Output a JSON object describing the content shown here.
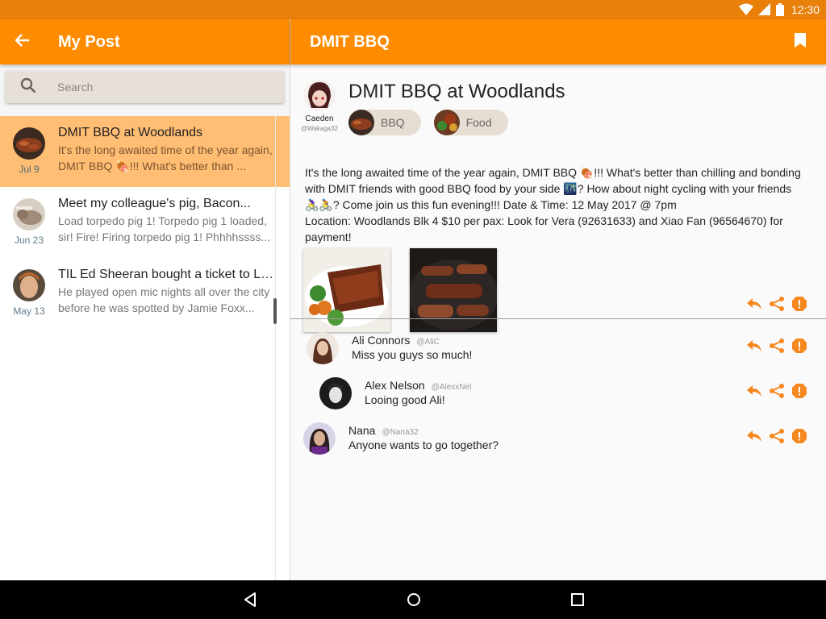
{
  "status_bar": {
    "time": "12:30"
  },
  "left_appbar": {
    "title": "My Post"
  },
  "search": {
    "placeholder": "Search"
  },
  "posts": [
    {
      "title": "DMIT BBQ at Woodlands",
      "snippet": "It's the long awaited time of the year again, DMIT BBQ 🍖!!! What's better than ...",
      "date": "Jul 9",
      "selected": true
    },
    {
      "title": "Meet my colleague's pig, Bacon...",
      "snippet": "Load torpedo pig 1! Torpedo pig 1 loaded, sir! Fire! Firing torpedo pig 1! Phhhhssss...",
      "date": "Jun 23",
      "selected": false
    },
    {
      "title": "TIL Ed Sheeran bought a ticket to LA...",
      "snippet": "He played open mic nights all over the city before he was spotted by Jamie Foxx...",
      "date": "May 13",
      "selected": false
    }
  ],
  "right_appbar": {
    "title": "DMIT BBQ"
  },
  "post": {
    "author_name": "Caeden",
    "author_handle": "@Wakaga32",
    "title": "DMIT BBQ at Woodlands",
    "tags": [
      "BBQ",
      "Food"
    ],
    "body_lines": [
      "It's the long awaited time of the year again, DMIT BBQ 🍖!!! What's better than chilling and bonding",
      "with DMIT friends with good BBQ food by your side 🌃? How about night cycling with your friends",
      "🚴‍♀️🚴? Come join us this fun evening!!! Date & Time: 12 May 2017 @ 7pm",
      "Location: Woodlands Blk 4 $10 per pax: Look for Vera (92631633) and Xiao Fan (96564670) for",
      "payment!"
    ]
  },
  "comments": [
    {
      "name": "Ali Connors",
      "handle": "@AliC",
      "text": "Miss you guys so much!"
    },
    {
      "name": "Alex Nelson",
      "handle": "@AlexxNel",
      "text": "Looing good Ali!"
    },
    {
      "name": "Nana",
      "handle": "@Nana32",
      "text": "Anyone wants to go together?"
    }
  ],
  "colors": {
    "primary": "#FF8C00",
    "status_bar": "#E8800A",
    "selected_row": "#FFBE73",
    "action_orange": "#F5881F"
  },
  "icons": [
    "wifi-icon",
    "signal-icon",
    "battery-icon",
    "back-arrow-icon",
    "search-icon",
    "bookmark-icon",
    "reply-icon",
    "share-icon",
    "report-icon",
    "nav-back-icon",
    "nav-home-icon",
    "nav-recents-icon"
  ]
}
